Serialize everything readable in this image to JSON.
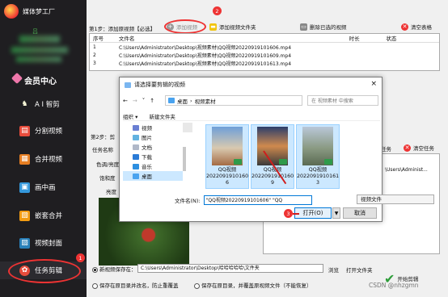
{
  "app": {
    "title": "媒体梦工厂",
    "user_name": "吕",
    "member_label": "会员中心"
  },
  "sidebar": {
    "items": [
      {
        "label": "A I 智剪",
        "icon": "ai-brain-icon"
      },
      {
        "label": "分割视频",
        "icon": "split-icon"
      },
      {
        "label": "合并视频",
        "icon": "merge-icon"
      },
      {
        "label": "画中画",
        "icon": "pip-icon"
      },
      {
        "label": "嵌套合并",
        "icon": "nest-icon"
      },
      {
        "label": "视频封面",
        "icon": "cover-icon"
      },
      {
        "label": "任务剪辑",
        "icon": "task-icon"
      }
    ]
  },
  "toolbar": {
    "step1_label": "第1步：添加原视频【必选】",
    "add_video": "添加视频",
    "add_folder": "添加视频文件夹",
    "delete_selected": "删除已选的视频",
    "clear_table": "清空表格"
  },
  "file_table": {
    "headers": [
      "序号",
      "文件名",
      "时长",
      "状态"
    ],
    "rows": [
      {
        "n": "1",
        "name": "C:\\Users\\Administrator\\Desktop\\视频素材\\QQ视频20220919101606.mp4"
      },
      {
        "n": "2",
        "name": "C:\\Users\\Administrator\\Desktop\\视频素材\\QQ视频20220919101609.mp4"
      },
      {
        "n": "3",
        "name": "C:\\Users\\Administrator\\Desktop\\视频素材\\QQ视频20220919101613.mp4"
      }
    ]
  },
  "step2": {
    "label": "第2步：剪",
    "task_name_label": "任务名称",
    "color_label": "色调/亮度",
    "saturation_label": "饱和度",
    "brightness_label": "亮度",
    "add_task": "任务",
    "clear_task": "清空任务",
    "task_preview": "\\Users\\Administ..."
  },
  "bottom": {
    "save_new_label": "新视频保存在：",
    "save_path": "C:\\Users\\Administrator\\Desktop\\哈哈哈哈哈\\文件夹",
    "browse": "浏览",
    "open_folder": "打开文件夹",
    "option_same_dir_rename": "保存在原目录并改名，防止重覆盖",
    "option_same_dir_overwrite": "保存在原目录，并覆盖原视频文件（不能恢复）",
    "start": "开始剪辑"
  },
  "dialog": {
    "title": "请选择要剪辑的视频",
    "close": "×",
    "path": [
      "桌面",
      "视频素材"
    ],
    "search_placeholder": "在 视频素材 中搜索",
    "organize": "组织 ▾",
    "new_folder": "新建文件夹",
    "tree": [
      "视频",
      "图片",
      "文档",
      "下载",
      "音乐",
      "桌面"
    ],
    "files": [
      {
        "name": "QQ视频2022091910160 6"
      },
      {
        "name": "QQ视频2022091910160 9"
      },
      {
        "name": "QQ视频2022091910161 3"
      }
    ],
    "filename_label": "文件名(N):",
    "filename_value": "\"QQ视频20220919101606\" \"QQ",
    "filetype": "视频文件",
    "open": "打开(O)",
    "cancel": "取消"
  },
  "annotations": [
    "1",
    "2",
    "3"
  ],
  "watermark": "CSDN @nhzgmn",
  "colors": {
    "sidebar_bg": "#1f1e21",
    "annotation_red": "#d01c1c",
    "selection_blue": "#cce8ff"
  }
}
